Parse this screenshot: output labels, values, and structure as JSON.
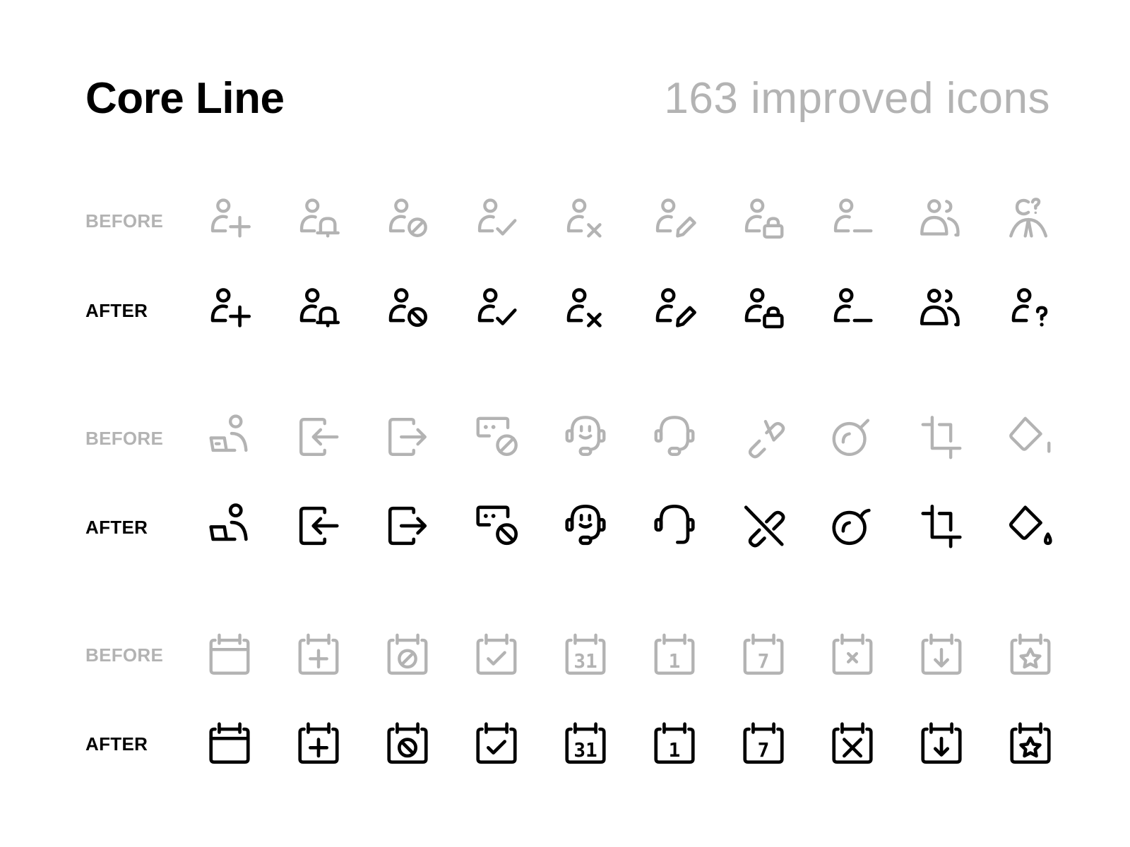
{
  "header": {
    "title": "Core Line",
    "subtitle": "163 improved icons"
  },
  "colors": {
    "before": "#b3b3b3",
    "after": "#000000",
    "background": "#ffffff"
  },
  "groups": [
    {
      "before_label": "BEFORE",
      "after_label": "AFTER",
      "icons": [
        "user-add-icon",
        "user-notification-icon",
        "user-block-icon",
        "user-check-icon",
        "user-remove-icon",
        "user-edit-icon",
        "user-lock-icon",
        "user-minus-icon",
        "user-group-icon",
        "user-question-icon"
      ]
    },
    {
      "before_label": "BEFORE",
      "after_label": "AFTER",
      "icons": [
        "user-laptop-icon",
        "login-icon",
        "logout-icon",
        "hidden-block-icon",
        "customer-support-icon",
        "headphones-icon",
        "unlink-icon",
        "bomb-icon",
        "crop-icon",
        "paint-bucket-icon"
      ]
    },
    {
      "before_label": "BEFORE",
      "after_label": "AFTER",
      "icons": [
        "calendar-icon",
        "calendar-add-icon",
        "calendar-block-icon",
        "calendar-check-icon",
        "calendar-31-icon",
        "calendar-1-icon",
        "calendar-7-icon",
        "calendar-remove-icon",
        "calendar-download-icon",
        "calendar-star-icon"
      ],
      "calendar_numbers": [
        "31",
        "1",
        "7"
      ]
    }
  ]
}
